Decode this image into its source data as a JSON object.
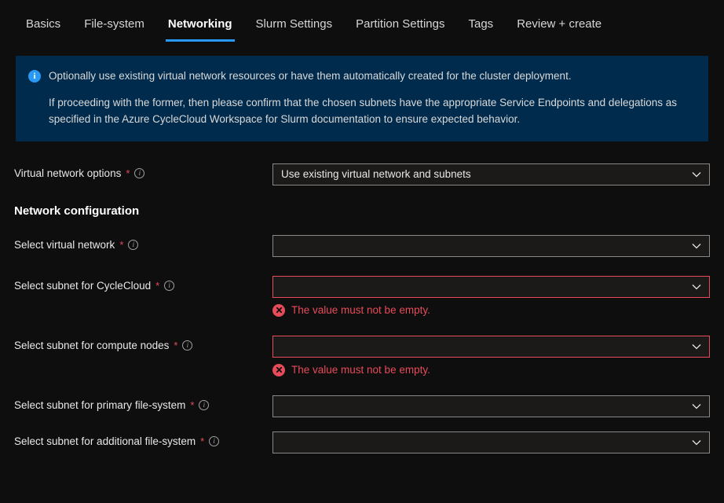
{
  "tabs": [
    {
      "label": "Basics"
    },
    {
      "label": "File-system"
    },
    {
      "label": "Networking",
      "active": true
    },
    {
      "label": "Slurm Settings"
    },
    {
      "label": "Partition Settings"
    },
    {
      "label": "Tags"
    },
    {
      "label": "Review + create"
    }
  ],
  "info": {
    "p1": "Optionally use existing virtual network resources or have them automatically created for the cluster deployment.",
    "p2": "If proceeding with the former, then please confirm that the chosen subnets have the appropriate Service Endpoints and delegations as specified in the Azure CycleCloud Workspace for Slurm documentation to ensure expected behavior."
  },
  "fields": {
    "vnet_options": {
      "label": "Virtual network options",
      "value": "Use existing virtual network and subnets"
    },
    "section_title": "Network configuration",
    "select_vnet": {
      "label": "Select virtual network",
      "value": ""
    },
    "subnet_cyclecloud": {
      "label": "Select subnet for CycleCloud",
      "value": "",
      "error": "The value must not be empty."
    },
    "subnet_compute": {
      "label": "Select subnet for compute nodes",
      "value": "",
      "error": "The value must not be empty."
    },
    "subnet_primary_fs": {
      "label": "Select subnet for primary file-system",
      "value": ""
    },
    "subnet_additional_fs": {
      "label": "Select subnet for additional file-system",
      "value": ""
    }
  }
}
